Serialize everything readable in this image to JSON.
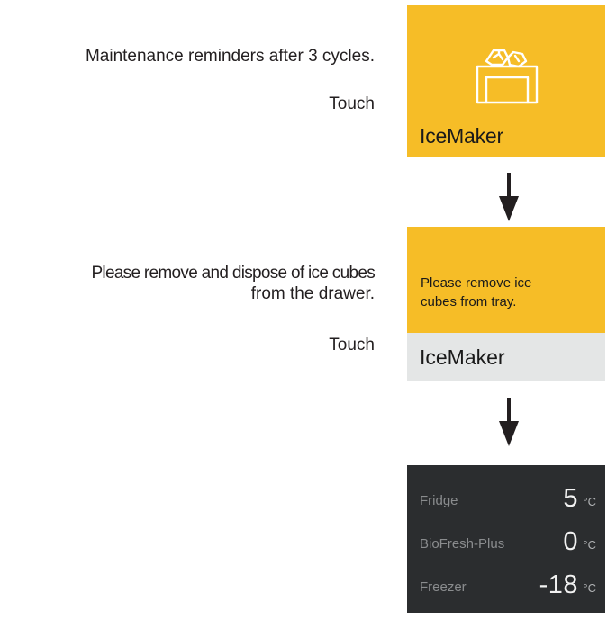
{
  "step1": {
    "instruction": "Maintenance reminders after 3 cycles.",
    "action": "Touch",
    "panel_label": "IceMaker",
    "icon": "ice-maker-icon"
  },
  "step2": {
    "instruction_line1": "Please remove and dispose of ice cubes",
    "instruction_line2": "from the drawer.",
    "action": "Touch",
    "panel_message_line1": "Please remove ice",
    "panel_message_line2": "cubes from tray.",
    "panel_label": "IceMaker"
  },
  "arrows": {
    "icon": "arrow-down-icon"
  },
  "status": {
    "rows": [
      {
        "name": "Fridge",
        "value": "5",
        "unit": "°C"
      },
      {
        "name": "BioFresh-Plus",
        "value": "0",
        "unit": "°C"
      },
      {
        "name": "Freezer",
        "value": "-18",
        "unit": "°C"
      }
    ]
  },
  "colors": {
    "accent": "#f6bd27",
    "secondary_panel": "#e4e6e6",
    "status_panel": "#2b2d2f"
  }
}
